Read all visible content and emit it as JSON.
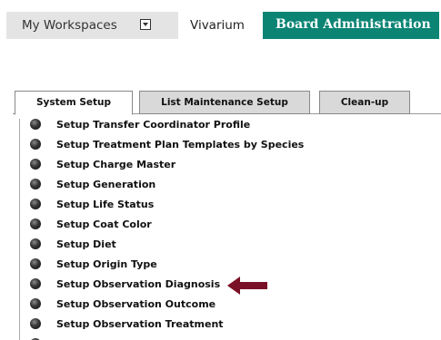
{
  "nav": {
    "workspaces": "My Workspaces",
    "vivarium": "Vivarium",
    "board": "Board Administration"
  },
  "tabs": [
    {
      "label": "System Setup",
      "active": true
    },
    {
      "label": "List Maintenance Setup",
      "active": false
    },
    {
      "label": "Clean-up",
      "active": false
    }
  ],
  "items": [
    "Setup Transfer Coordinator Profile",
    "Setup Treatment Plan Templates by Species",
    "Setup Charge Master",
    "Setup Generation",
    "Setup Life Status",
    "Setup Coat Color",
    "Setup Diet",
    "Setup Origin Type",
    "Setup Observation Diagnosis",
    "Setup Observation Outcome",
    "Setup Observation Treatment"
  ],
  "colors": {
    "brand": "#0b8474",
    "arrow": "#7a1026"
  }
}
